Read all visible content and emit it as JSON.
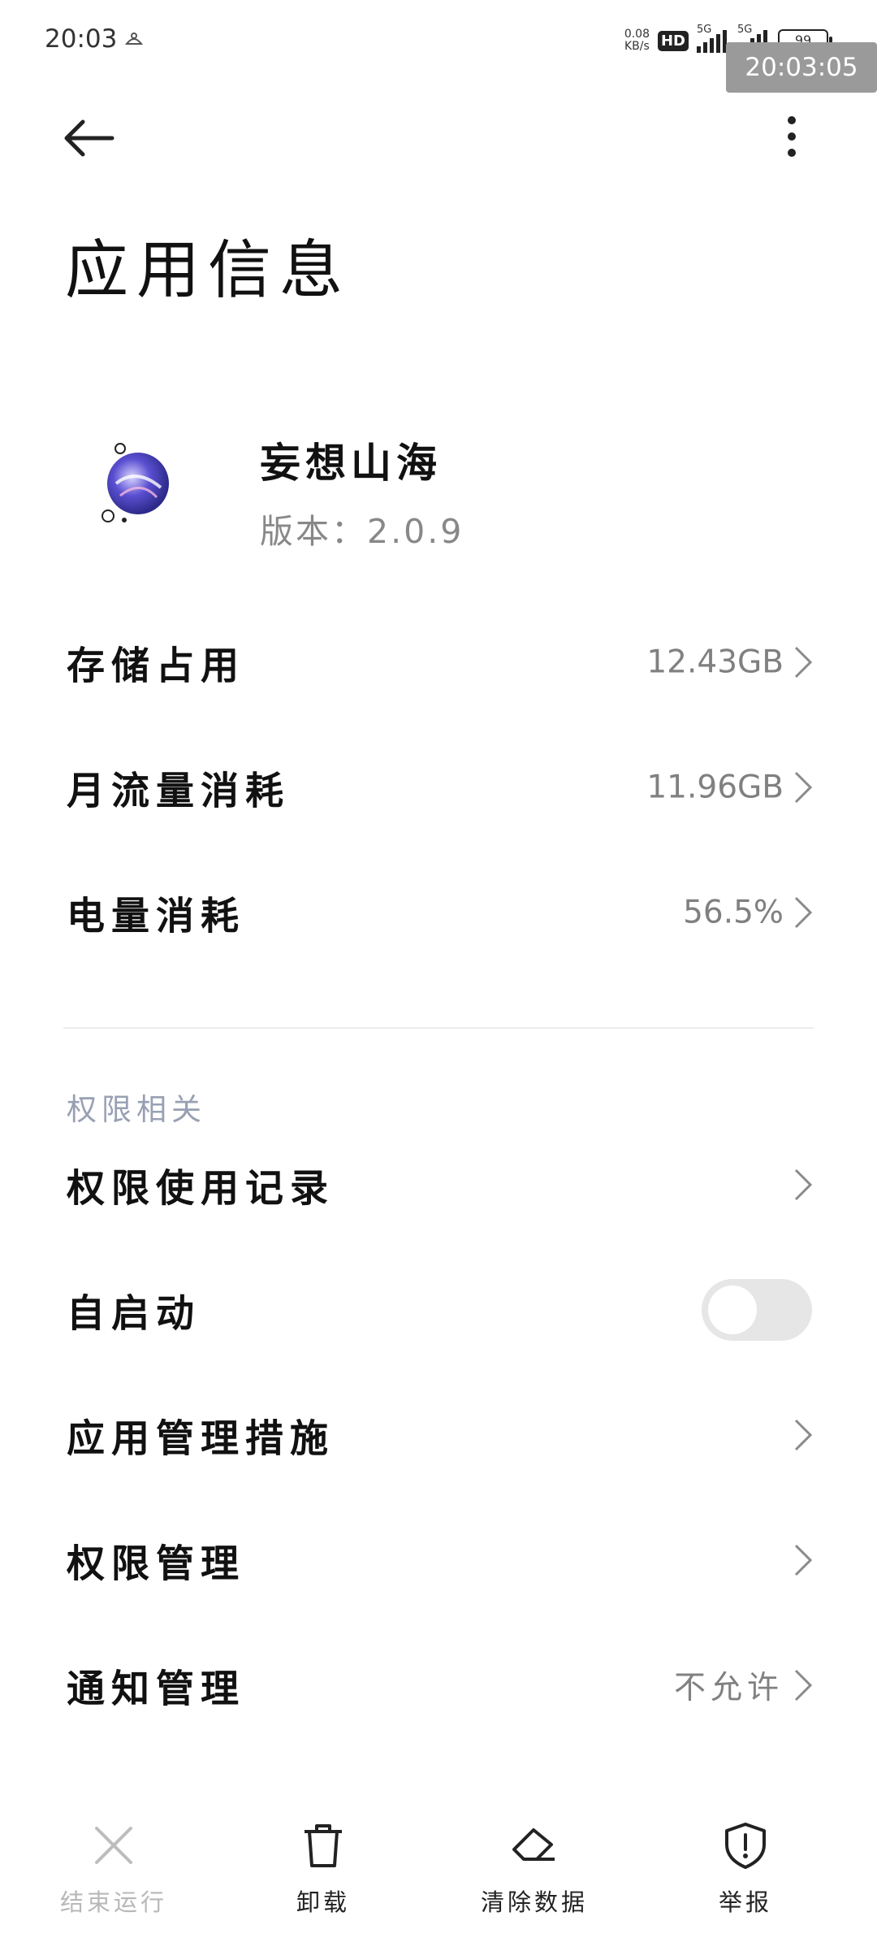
{
  "status_bar": {
    "time": "20:03",
    "net_speed_value": "0.08",
    "net_speed_unit": "KB/s",
    "hd_badge": "HD",
    "network_1": "5G",
    "network_2": "5G",
    "battery": "99",
    "overlay_time": "20:03:05"
  },
  "header": {
    "back_icon": "arrow-left-icon",
    "more_icon": "more-vertical-icon"
  },
  "page": {
    "title": "应用信息"
  },
  "app": {
    "name": "妄想山海",
    "version": "版本：2.0.9"
  },
  "usage": [
    {
      "label": "存储占用",
      "value": "12.43GB"
    },
    {
      "label": "月流量消耗",
      "value": "11.96GB"
    },
    {
      "label": "电量消耗",
      "value": "56.5%"
    }
  ],
  "permissions": {
    "section_title": "权限相关",
    "items": [
      {
        "label": "权限使用记录",
        "value": ""
      },
      {
        "label": "自启动",
        "toggle_on": false
      },
      {
        "label": "应用管理措施",
        "value": ""
      },
      {
        "label": "权限管理",
        "value": ""
      },
      {
        "label": "通知管理",
        "value": "不允许"
      }
    ]
  },
  "bottom_bar": {
    "items": [
      {
        "label": "结束运行",
        "icon": "close-icon",
        "enabled": false
      },
      {
        "label": "卸载",
        "icon": "trash-icon",
        "enabled": true
      },
      {
        "label": "清除数据",
        "icon": "eraser-icon",
        "enabled": true
      },
      {
        "label": "举报",
        "icon": "shield-alert-icon",
        "enabled": true
      }
    ]
  },
  "colors": {
    "background": "#ffffff",
    "text_primary": "#111111",
    "text_secondary": "#808080",
    "section_header": "#98a0b3",
    "toggle_off": "#e6e6e6"
  }
}
